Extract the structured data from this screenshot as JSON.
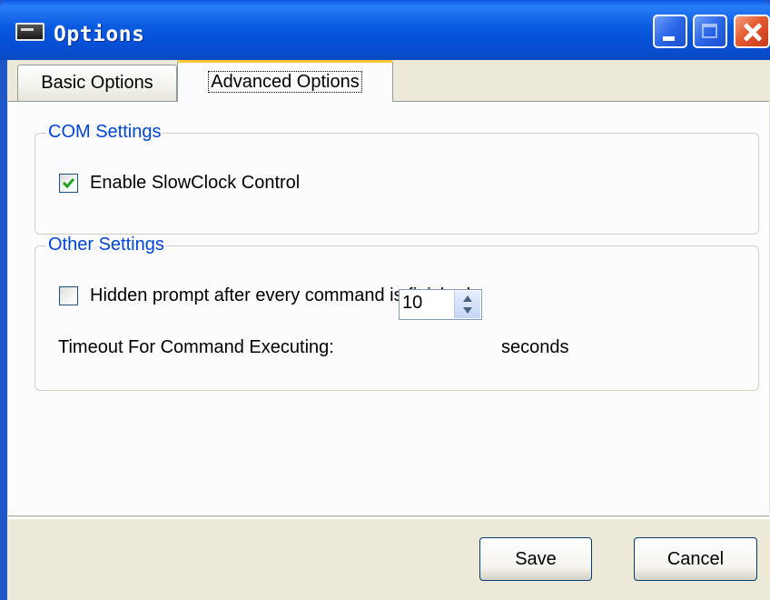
{
  "window": {
    "title": "Options",
    "buttons": {
      "minimize": "minimize-icon",
      "maximize": "maximize-icon",
      "close": "close-icon"
    }
  },
  "tabs": [
    {
      "label": "Basic Options",
      "selected": false
    },
    {
      "label": "Advanced Options",
      "selected": true
    }
  ],
  "com_settings": {
    "title": "COM Settings",
    "enable_slowclock": {
      "label": "Enable SlowClock Control",
      "checked": true
    }
  },
  "other_settings": {
    "title": "Other Settings",
    "hidden_prompt": {
      "label": "Hidden prompt after every command is finished",
      "checked": false
    },
    "timeout": {
      "label": "Timeout For Command Executing:",
      "value": "10",
      "unit": "seconds"
    }
  },
  "footer": {
    "save_label": "Save",
    "cancel_label": "Cancel"
  },
  "colors": {
    "group_title": "#0046d5",
    "titlebar": "#0a57e3",
    "client_bg": "#ece9d8"
  }
}
